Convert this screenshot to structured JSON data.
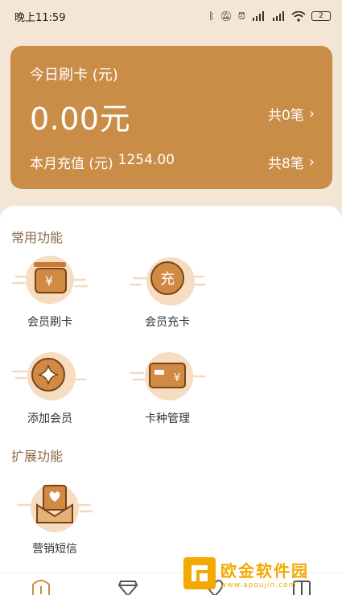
{
  "status_bar": {
    "time": "晚上11:59",
    "battery": "2",
    "icons": [
      "bluetooth-icon",
      "mute-icon",
      "alarm-icon",
      "signal-hd-icon",
      "signal-hd-icon",
      "wifi-icon",
      "battery-icon"
    ]
  },
  "summary": {
    "today_label": "今日刷卡 (元)",
    "today_amount": "0.00元",
    "today_count": "共0笔",
    "month_label": "本月充值 (元)",
    "month_amount": "1254.00",
    "month_count": "共8笔"
  },
  "common": {
    "title": "常用功能",
    "items": [
      {
        "label": "会员刷卡",
        "icon": "wallet-yuan-icon"
      },
      {
        "label": "会员充卡",
        "icon": "recharge-coin-icon"
      },
      {
        "label": "添加会员",
        "icon": "add-member-star-icon"
      },
      {
        "label": "卡种管理",
        "icon": "card-yuan-icon"
      }
    ]
  },
  "extended": {
    "title": "扩展功能",
    "items": [
      {
        "label": "营销短信",
        "icon": "heart-envelope-icon"
      }
    ]
  },
  "bottom_nav": {
    "icons": [
      "home-icon",
      "diamond-icon",
      "heart-icon",
      "grid-icon"
    ]
  },
  "watermark": {
    "title": "欧金软件园",
    "url": "www.apoujin.com"
  },
  "colors": {
    "brand": "#c98d47",
    "background": "#f3e6d6",
    "icon_light": "#f6dcc0",
    "icon_dark": "#c97a35",
    "section_title": "#8a6b4a"
  }
}
